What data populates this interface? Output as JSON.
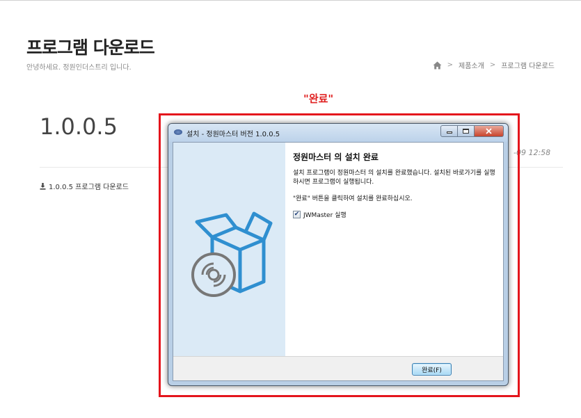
{
  "page": {
    "title": "프로그램 다운로드",
    "subtitle": "안녕하세요. 정원인더스트리 입니다."
  },
  "breadcrumb": {
    "icon": "home-icon",
    "items": [
      "제품소개",
      "프로그램 다운로드"
    ],
    "separator": ">"
  },
  "annotation": {
    "callout": "\"완료\"",
    "frame_color": "#e4151c"
  },
  "release": {
    "version": "1.0.0.5",
    "timestamp_visible": "-09 12:58",
    "download_label": "1.0.0.5 프로그램 다운로드",
    "download_icon": "download-icon"
  },
  "installer": {
    "window_title": "설치 - 정원마스터 버전 1.0.0.5",
    "heading": "정원마스터 의 설치 완료",
    "description": "설치 프로그램이 정원마스터 의 설치를 완료했습니다. 설치된 바로가기를 실행하시면 프로그램이 실행됩니다.",
    "instruction": "\"완료\" 버튼을 클릭하여 설치를 완료하십시오.",
    "checkbox": {
      "label": "JWMaster 실행",
      "checked": true
    },
    "finish_button": "완료(F)",
    "art_icon": "software-box-icon",
    "accent_color": "#2f8fd0"
  }
}
